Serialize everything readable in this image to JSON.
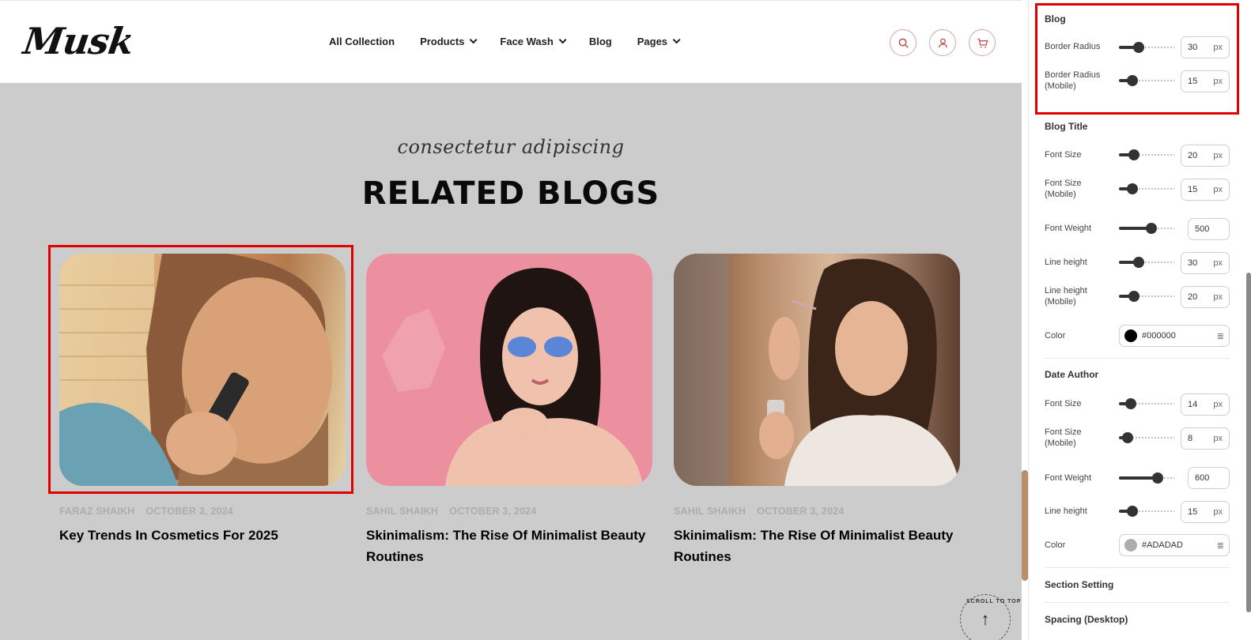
{
  "header": {
    "logo": "Musk",
    "nav": [
      {
        "label": "All Collection",
        "dropdown": false
      },
      {
        "label": "Products",
        "dropdown": true
      },
      {
        "label": "Face Wash",
        "dropdown": true
      },
      {
        "label": "Blog",
        "dropdown": false
      },
      {
        "label": "Pages",
        "dropdown": true
      }
    ],
    "icons": [
      "search-icon",
      "user-icon",
      "cart-icon"
    ]
  },
  "section": {
    "subtitle": "consectetur adipiscing",
    "heading": "RELATED BLOGS"
  },
  "blogs": [
    {
      "author": "FARAZ SHAIKH",
      "date": "OCTOBER 3, 2024",
      "title": "Key Trends In Cosmetics For 2025"
    },
    {
      "author": "SAHIL SHAIKH",
      "date": "OCTOBER 3, 2024",
      "title": "Skinimalism: The Rise Of Minimalist Beauty Routines"
    },
    {
      "author": "SAHIL SHAIKH",
      "date": "OCTOBER 3, 2024",
      "title": "Skinimalism: The Rise Of Minimalist Beauty Routines"
    }
  ],
  "scroll_top": {
    "label": "SCROLL TO TOP"
  },
  "panel": {
    "blog": {
      "title": "Blog",
      "border_radius": {
        "label": "Border Radius",
        "value": "30",
        "unit": "px"
      },
      "border_radius_mobile": {
        "label": "Border Radius (Mobile)",
        "value": "15",
        "unit": "px"
      }
    },
    "blog_title": {
      "title": "Blog Title",
      "font_size": {
        "label": "Font Size",
        "value": "20",
        "unit": "px"
      },
      "font_size_mobile": {
        "label": "Font Size (Mobile)",
        "value": "15",
        "unit": "px"
      },
      "font_weight": {
        "label": "Font Weight",
        "value": "500"
      },
      "line_height": {
        "label": "Line height",
        "value": "30",
        "unit": "px"
      },
      "line_height_mobile": {
        "label": "Line height (Mobile)",
        "value": "20",
        "unit": "px"
      },
      "color": {
        "label": "Color",
        "value": "#000000"
      }
    },
    "date_author": {
      "title": "Date Author",
      "font_size": {
        "label": "Font Size",
        "value": "14",
        "unit": "px"
      },
      "font_size_mobile": {
        "label": "Font Size (Mobile)",
        "value": "8",
        "unit": "px"
      },
      "font_weight": {
        "label": "Font Weight",
        "value": "600"
      },
      "line_height": {
        "label": "Line height",
        "value": "15",
        "unit": "px"
      },
      "color": {
        "label": "Color",
        "value": "#ADADAD"
      }
    },
    "section_setting": "Section Setting",
    "spacing_desktop": "Spacing (Desktop)"
  },
  "colors": {
    "accent": "#e00000",
    "brand_icon": "#c0504d",
    "meta_text": "#ADADAD"
  }
}
